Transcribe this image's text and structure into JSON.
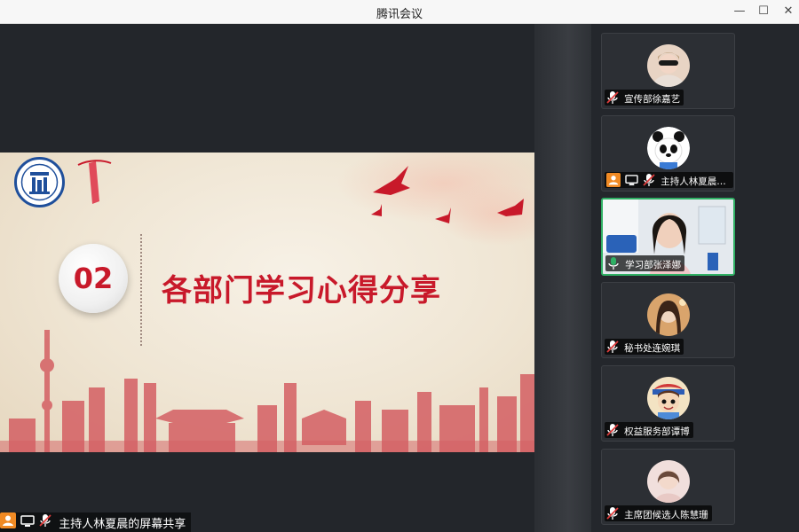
{
  "window": {
    "title": "腾讯会议",
    "controls": {
      "minimize": "—",
      "maximize": "☐",
      "close": "✕"
    }
  },
  "slide": {
    "number": "02",
    "title": "各部门学习心得分享"
  },
  "share_bar": {
    "label": "主持人林夏晨的屏幕共享"
  },
  "participants": [
    {
      "name": "宣传部徐嘉艺",
      "mic": "muted",
      "host": false,
      "video": false
    },
    {
      "name": "主持人林夏晨的...",
      "mic": "muted",
      "host": true,
      "video": false
    },
    {
      "name": "学习部张泽娜",
      "mic": "active",
      "host": false,
      "video": true
    },
    {
      "name": "秘书处连婉琪",
      "mic": "muted",
      "host": false,
      "video": false
    },
    {
      "name": "权益服务部谭博",
      "mic": "muted",
      "host": false,
      "video": false
    },
    {
      "name": "主席团候选人陈慧珊",
      "mic": "muted",
      "host": false,
      "video": false
    }
  ],
  "colors": {
    "accent_green": "#2fb064",
    "slide_red": "#c8192a",
    "host_orange": "#f08a24",
    "mic_muted_red": "#e03c3c"
  }
}
